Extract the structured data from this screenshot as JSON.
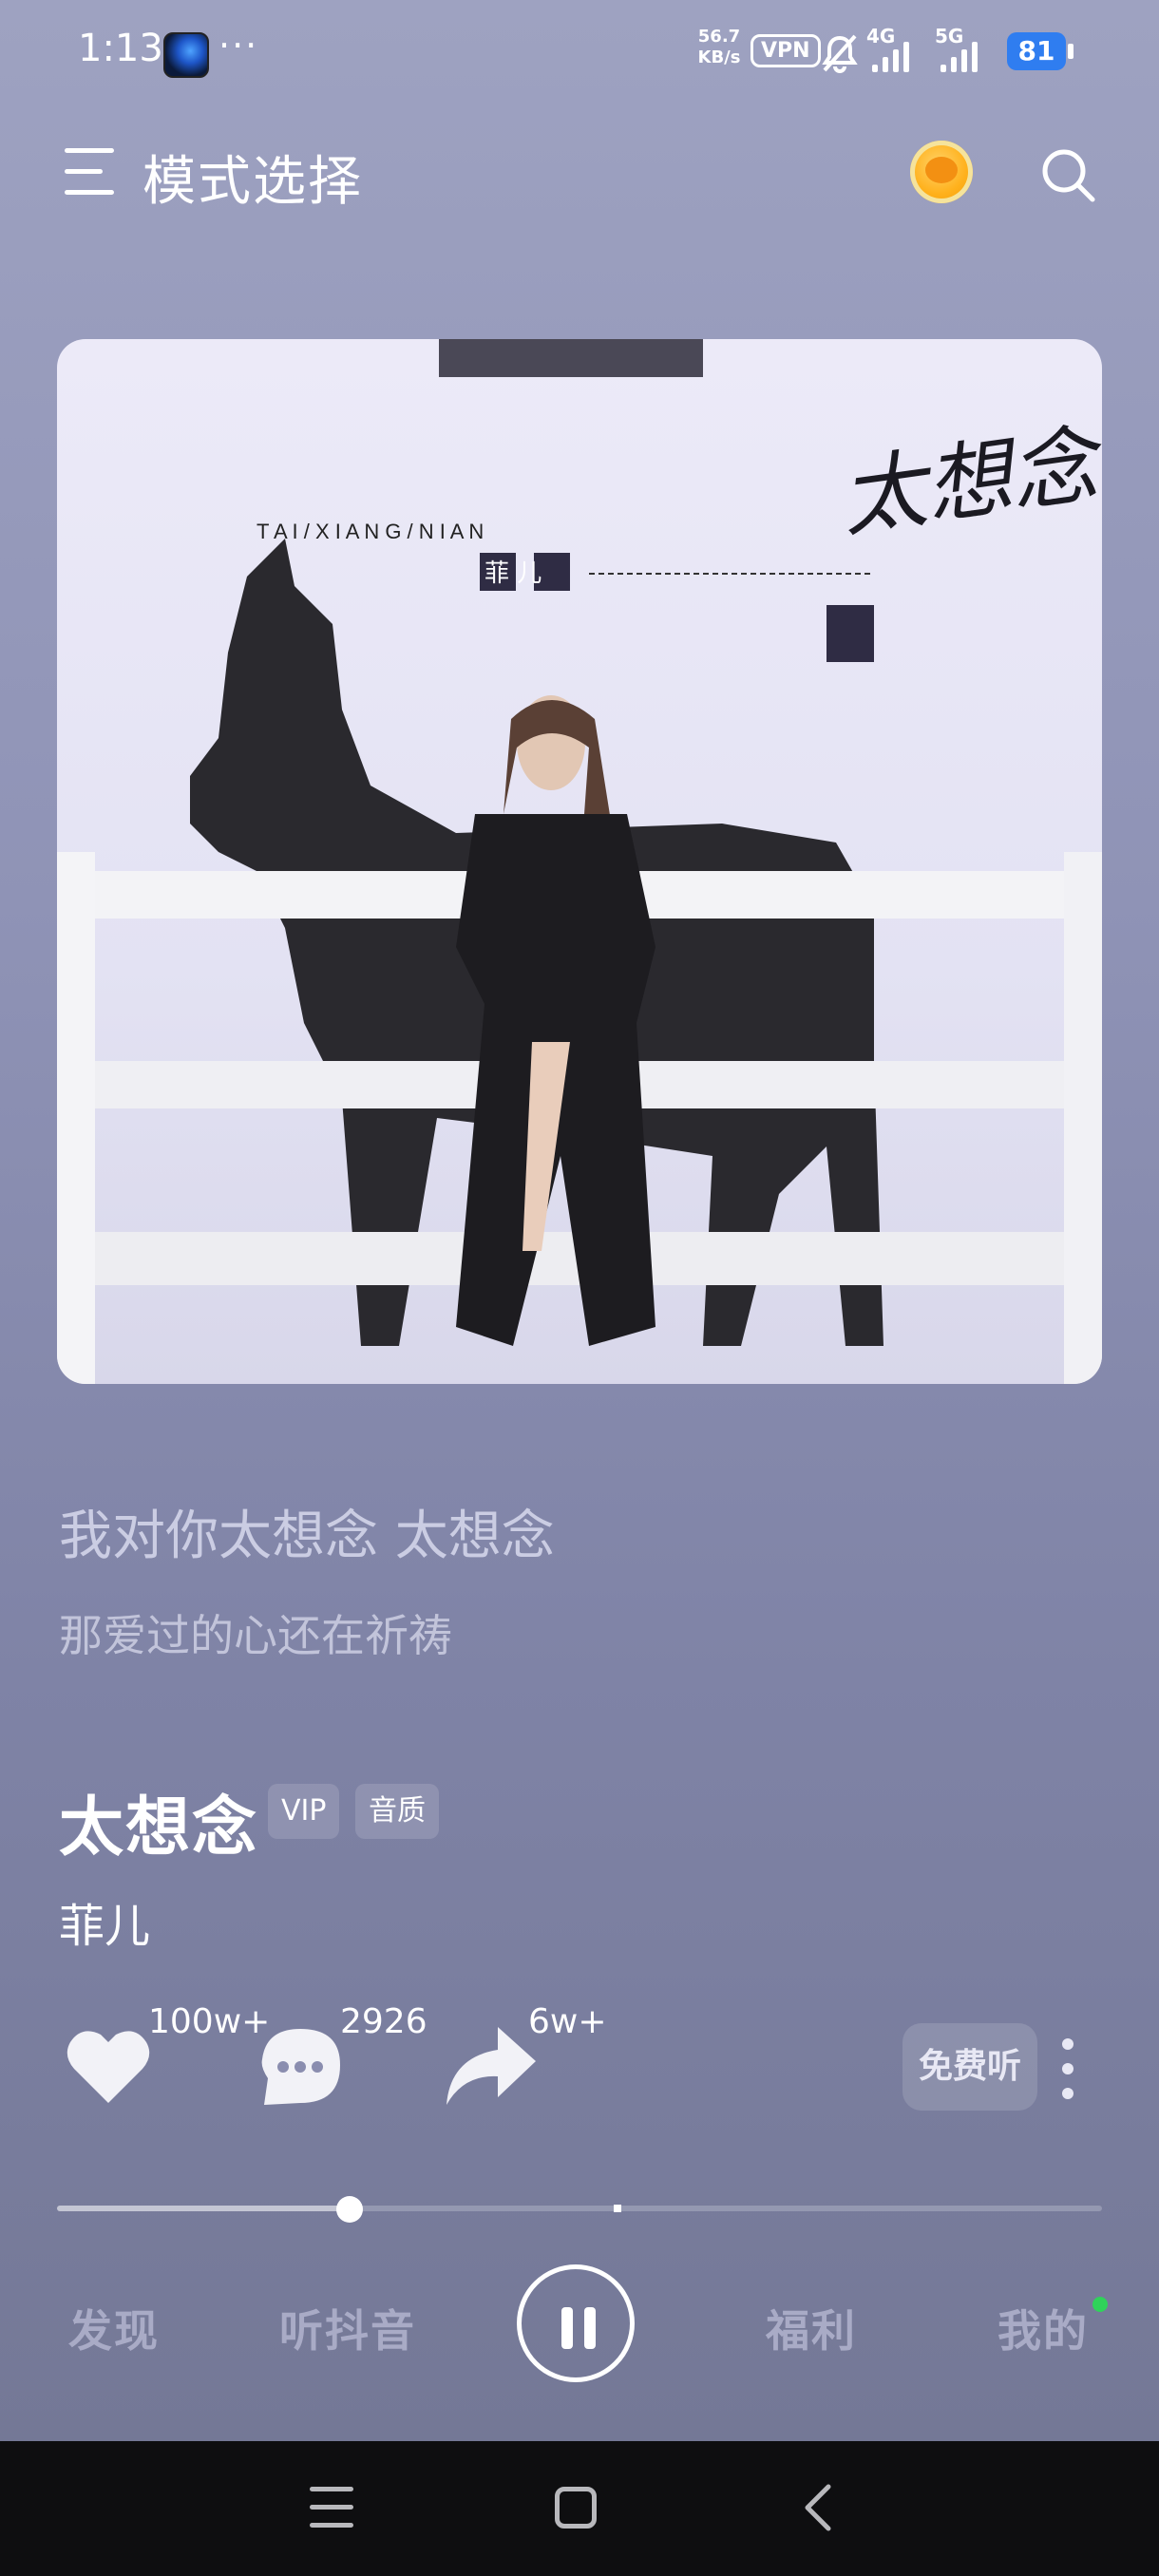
{
  "status_bar": {
    "time": "1:13",
    "more": "···",
    "net_speed_value": "56.7",
    "net_speed_unit": "KB/s",
    "vpn": "VPN",
    "signal_1": "4G",
    "signal_2": "5G",
    "battery": "81"
  },
  "header": {
    "menu_icon": "hamburger-menu-icon",
    "title": "模式选择",
    "coin_icon": "gold-coin-icon",
    "search_icon": "search-icon"
  },
  "album": {
    "cover_title_pinyin": "T A I / X I A N G / N I A N",
    "cover_artist": "菲 儿",
    "cover_title": "太想念"
  },
  "lyrics": {
    "current": "我对你太想念 太想念",
    "next": "那爱过的心还在祈祷"
  },
  "song": {
    "title": "太想念",
    "badge_vip": "VIP",
    "badge_quality": "音质",
    "artist": "菲儿"
  },
  "actions": {
    "like_count": "100w+",
    "comment_count": "2926",
    "share_count": "6w+",
    "free_listen": "免费听"
  },
  "player": {
    "progress": 0.28
  },
  "bottom_nav": {
    "discover": "发现",
    "douyin": "听抖音",
    "welfare": "福利",
    "mine": "我的"
  },
  "colors": {
    "accent_green": "#2fd35a",
    "battery_blue": "#2f7df0",
    "coin_gold": "#ffb11c"
  }
}
